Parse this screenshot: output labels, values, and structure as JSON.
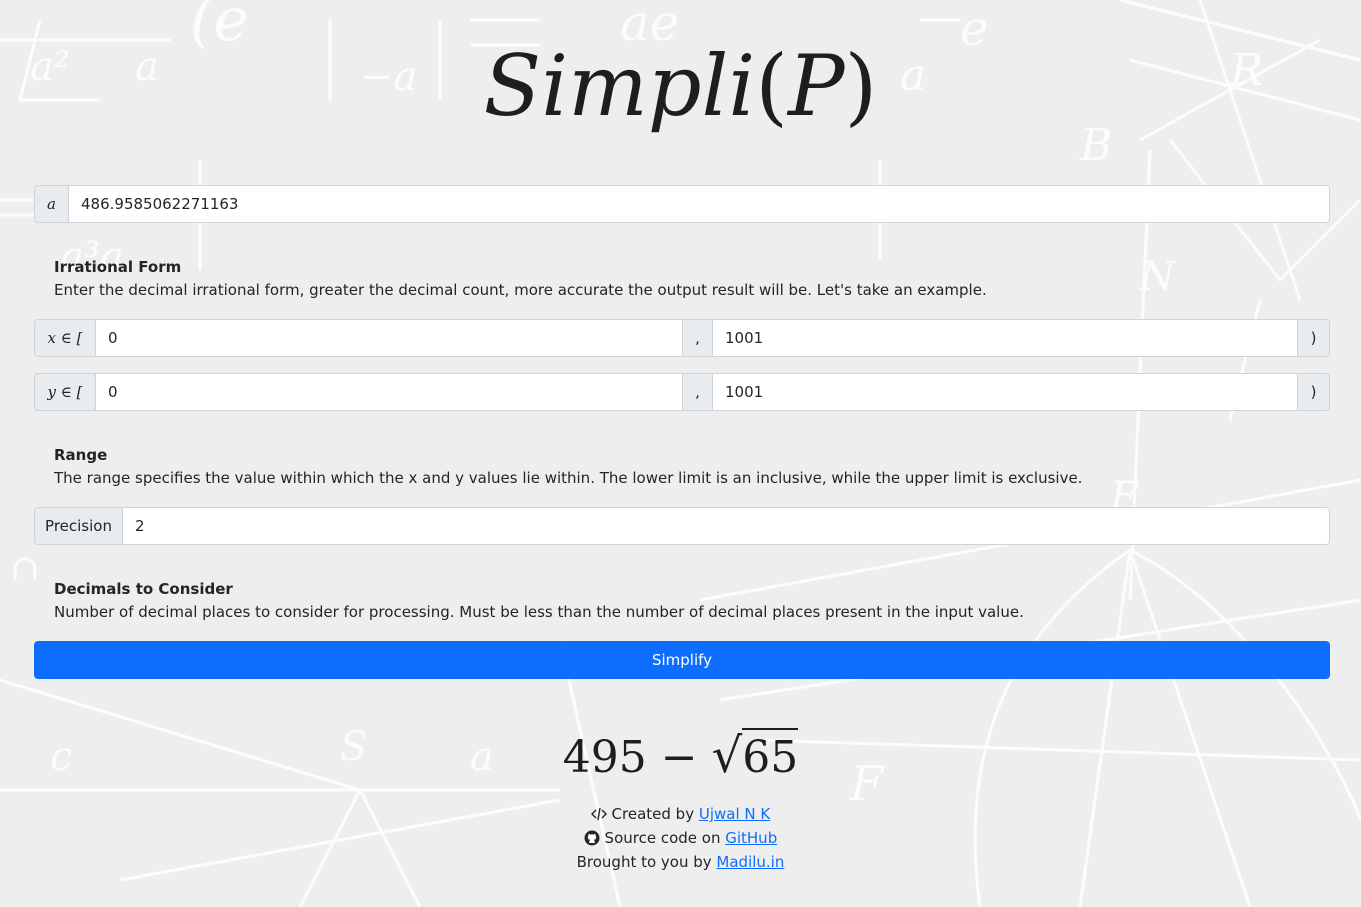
{
  "title": {
    "main": "Simpli",
    "open_paren": "(",
    "var": "P",
    "close_paren": ")"
  },
  "input_a": {
    "label": "a",
    "value": "486.9585062271163"
  },
  "irrational_help": {
    "heading": "Irrational Form",
    "text": "Enter the decimal irrational form, greater the decimal count, more accurate the output result will be. Let's take an example."
  },
  "range_x": {
    "label": "x ∈ [",
    "lower": "0",
    "separator": ",",
    "upper": "1001",
    "close": ")"
  },
  "range_y": {
    "label": "y ∈ [",
    "lower": "0",
    "separator": ",",
    "upper": "1001",
    "close": ")"
  },
  "range_help": {
    "heading": "Range",
    "text": "The range specifies the value within which the x and y values lie within. The lower limit is an inclusive, while the upper limit is exclusive."
  },
  "precision": {
    "label": "Precision",
    "value": "2"
  },
  "decimals_help": {
    "heading": "Decimals to Consider",
    "text": "Number of decimal places to consider for processing. Must be less than the number of decimal places present in the input value."
  },
  "simplify_button": "Simplify",
  "result": {
    "lhs": "495",
    "op": "−",
    "radical": "√",
    "radicand": "65"
  },
  "footer": {
    "created_icon": "code-icon",
    "created_prefix": "Created by ",
    "created_link": "Ujwal N K",
    "source_icon": "github-icon",
    "source_prefix": "Source code on ",
    "source_link": "GitHub",
    "brought_prefix": "Brought to you by ",
    "brought_link": "Madilu.in"
  },
  "colors": {
    "background": "#eeeeee",
    "primary": "#0d6efd",
    "addon": "#e9ecef",
    "border": "#ced4da"
  }
}
